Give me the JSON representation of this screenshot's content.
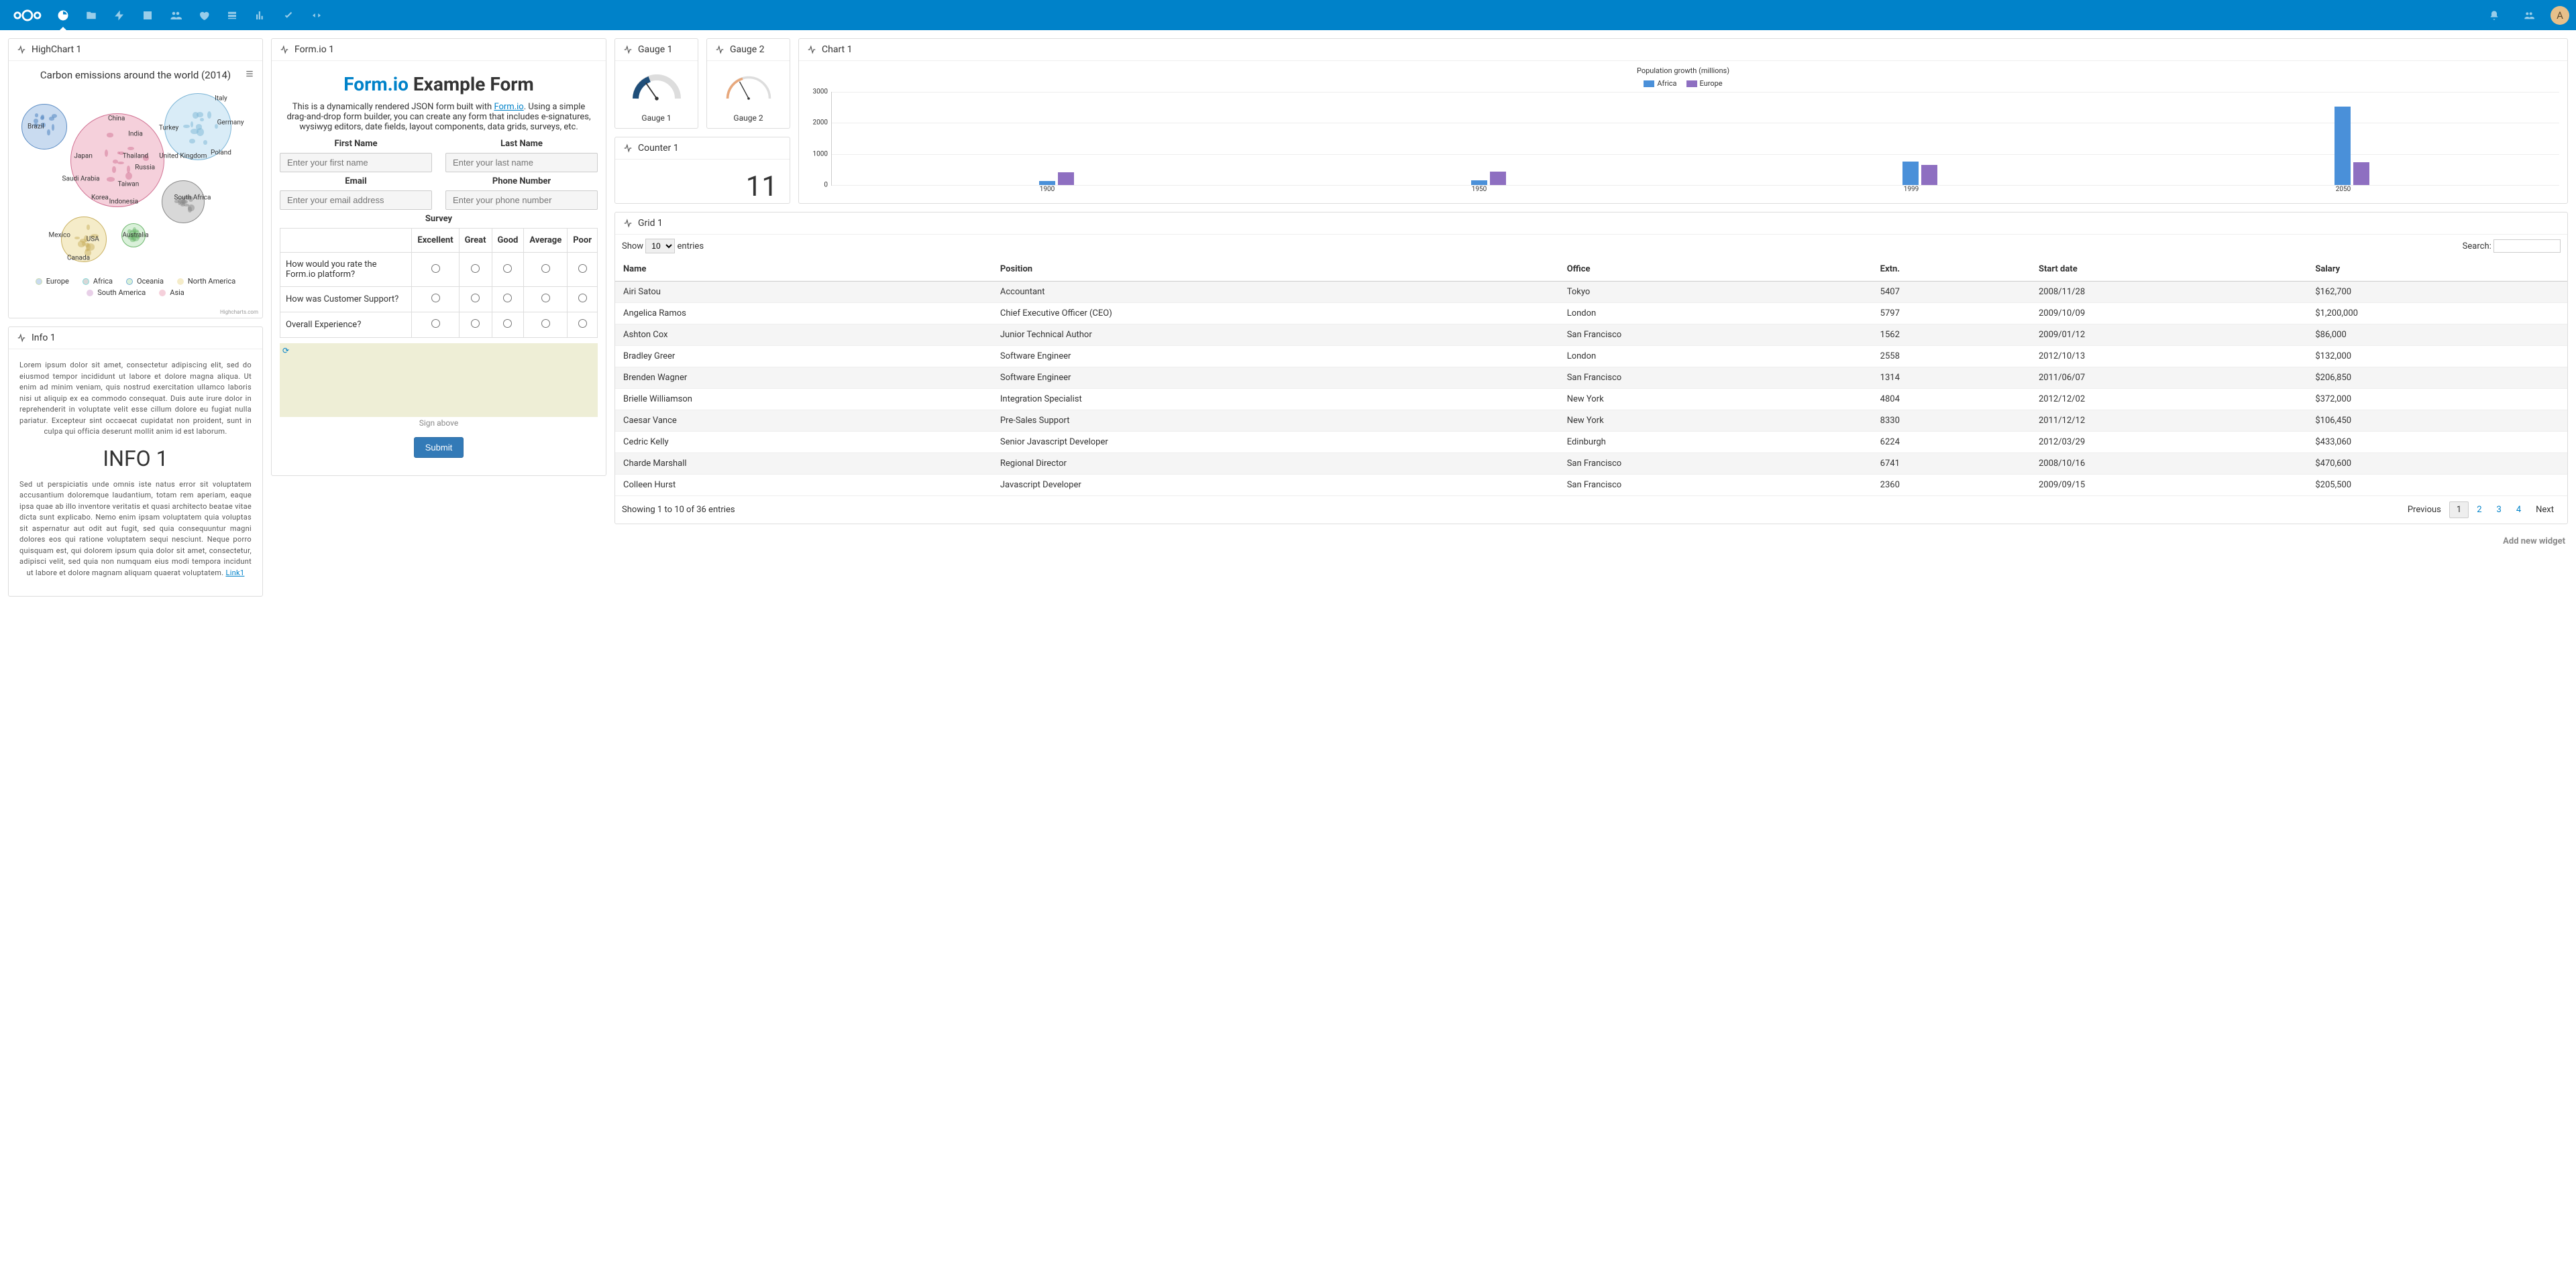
{
  "header": {
    "avatar_letter": "A"
  },
  "widgets": {
    "highchart": {
      "title": "HighChart 1",
      "chart_title": "Carbon emissions around the world (2014)",
      "credits": "Highcharts.com",
      "legend": [
        "Europe",
        "Africa",
        "Oceania",
        "North America",
        "South America",
        "Asia"
      ],
      "labels": [
        "Italy",
        "Germany",
        "Turkey",
        "United Kingdom",
        "Poland",
        "China",
        "India",
        "Thailand",
        "Russia",
        "Japan",
        "Saudi Arabia",
        "Taiwan",
        "Korea",
        "Indonesia",
        "South Africa",
        "Australia",
        "Mexico",
        "USA",
        "Canada",
        "Brazil"
      ]
    },
    "info": {
      "title": "Info 1",
      "p1": "Lorem ipsum dolor sit amet, consectetur adipiscing elit, sed do eiusmod tempor incididunt ut labore et dolore magna aliqua. Ut enim ad minim veniam, quis nostrud exercitation ullamco laboris nisi ut aliquip ex ea commodo consequat. Duis aute irure dolor in reprehenderit in voluptate velit esse cillum dolore eu fugiat nulla pariatur. Excepteur sint occaecat cupidatat non proident, sunt in culpa qui officia deserunt mollit anim id est laborum.",
      "heading": "INFO 1",
      "p2": "Sed ut perspiciatis unde omnis iste natus error sit voluptatem accusantium doloremque laudantium, totam rem aperiam, eaque ipsa quae ab illo inventore veritatis et quasi architecto beatae vitae dicta sunt explicabo. Nemo enim ipsam voluptatem quia voluptas sit aspernatur aut odit aut fugit, sed quia consequuntur magni dolores eos qui ratione voluptatem sequi nesciunt. Neque porro quisquam est, qui dolorem ipsum quia dolor sit amet, consectetur, adipisci velit, sed quia non numquam eius modi tempora incidunt ut labore et dolore magnam aliquam quaerat voluptatem. ",
      "link": "Link1"
    },
    "form": {
      "title": "Form.io 1",
      "heading_link": "Form.io",
      "heading_rest": " Example Form",
      "desc_pre": "This is a dynamically rendered JSON form built with ",
      "desc_link": "Form.io",
      "desc_post": ". Using a simple drag-and-drop form builder, you can create any form that includes e-signatures, wysiwyg editors, date fields, layout components, data grids, surveys, etc.",
      "labels": {
        "first": "First Name",
        "last": "Last Name",
        "email": "Email",
        "phone": "Phone Number",
        "survey": "Survey"
      },
      "placeholders": {
        "first": "Enter your first name",
        "last": "Enter your last name",
        "email": "Enter your email address",
        "phone": "Enter your phone number"
      },
      "survey_cols": [
        "Excellent",
        "Great",
        "Good",
        "Average",
        "Poor"
      ],
      "survey_rows": [
        "How would you rate the Form.io platform?",
        "How was Customer Support?",
        "Overall Experience?"
      ],
      "sign_label": "Sign above",
      "submit": "Submit"
    },
    "gauge1": {
      "title": "Gauge 1",
      "label": "Gauge 1"
    },
    "gauge2": {
      "title": "Gauge 2",
      "label": "Gauge 2"
    },
    "counter": {
      "title": "Counter 1",
      "value": "11"
    },
    "chart1": {
      "title": "Chart 1"
    },
    "grid": {
      "title": "Grid 1",
      "show_pre": "Show",
      "show_val": "10",
      "show_post": "entries",
      "search_label": "Search:",
      "columns": [
        "Name",
        "Position",
        "Office",
        "Extn.",
        "Start date",
        "Salary"
      ],
      "rows": [
        [
          "Airi Satou",
          "Accountant",
          "Tokyo",
          "5407",
          "2008/11/28",
          "$162,700"
        ],
        [
          "Angelica Ramos",
          "Chief Executive Officer (CEO)",
          "London",
          "5797",
          "2009/10/09",
          "$1,200,000"
        ],
        [
          "Ashton Cox",
          "Junior Technical Author",
          "San Francisco",
          "1562",
          "2009/01/12",
          "$86,000"
        ],
        [
          "Bradley Greer",
          "Software Engineer",
          "London",
          "2558",
          "2012/10/13",
          "$132,000"
        ],
        [
          "Brenden Wagner",
          "Software Engineer",
          "San Francisco",
          "1314",
          "2011/06/07",
          "$206,850"
        ],
        [
          "Brielle Williamson",
          "Integration Specialist",
          "New York",
          "4804",
          "2012/12/02",
          "$372,000"
        ],
        [
          "Caesar Vance",
          "Pre-Sales Support",
          "New York",
          "8330",
          "2011/12/12",
          "$106,450"
        ],
        [
          "Cedric Kelly",
          "Senior Javascript Developer",
          "Edinburgh",
          "6224",
          "2012/03/29",
          "$433,060"
        ],
        [
          "Charde Marshall",
          "Regional Director",
          "San Francisco",
          "6741",
          "2008/10/16",
          "$470,600"
        ],
        [
          "Colleen Hurst",
          "Javascript Developer",
          "San Francisco",
          "2360",
          "2009/09/15",
          "$205,500"
        ]
      ],
      "footer_info": "Showing 1 to 10 of 36 entries",
      "pager": {
        "prev": "Previous",
        "pages": [
          "1",
          "2",
          "3",
          "4"
        ],
        "next": "Next"
      }
    },
    "add_widget": "Add new widget"
  },
  "chart_data": {
    "type": "bar",
    "title": "Population growth (millions)",
    "series": [
      {
        "name": "Africa",
        "color": "#4a90d9",
        "values": [
          120,
          150,
          750,
          2500
        ]
      },
      {
        "name": "Europe",
        "color": "#8e6fc1",
        "values": [
          400,
          420,
          650,
          720
        ]
      }
    ],
    "categories": [
      "1900",
      "1950",
      "1999",
      "2050"
    ],
    "ylim": [
      0,
      3000
    ],
    "yticks": [
      0,
      1000,
      2000,
      3000
    ]
  }
}
